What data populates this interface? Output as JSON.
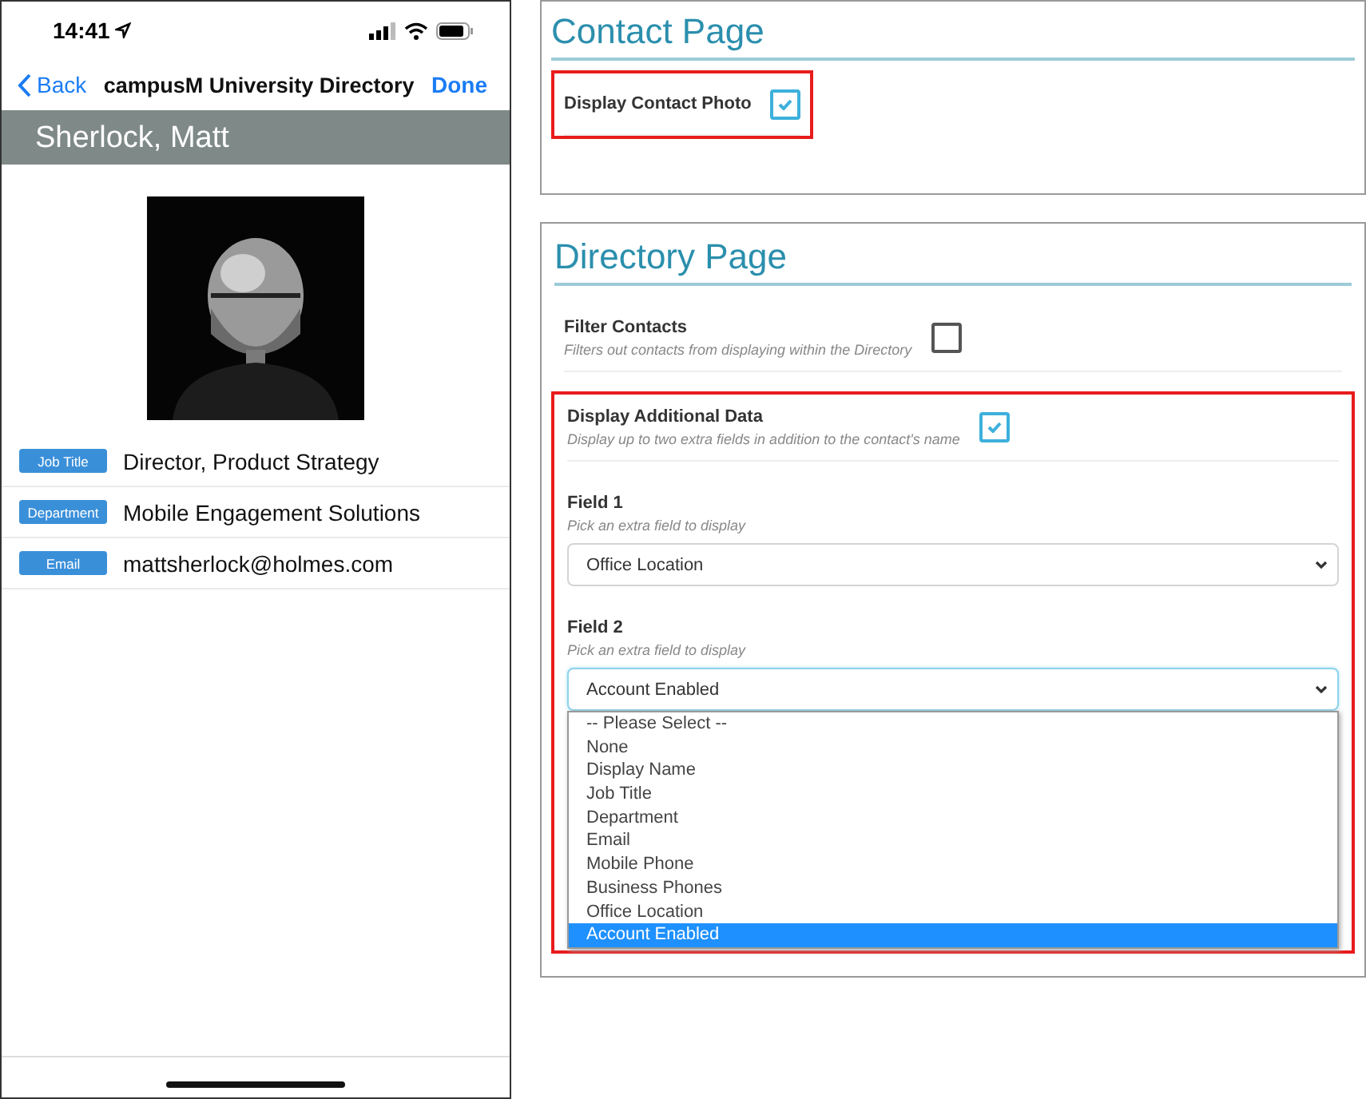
{
  "phone": {
    "status_bar": {
      "time": "14:41"
    },
    "nav": {
      "back": "Back",
      "title": "campusM University Directory",
      "done": "Done"
    },
    "contact_name": "Sherlock, Matt",
    "fields": [
      {
        "label": "Job Title",
        "value": "Director, Product Strategy"
      },
      {
        "label": "Department",
        "value": "Mobile Engagement Solutions"
      },
      {
        "label": "Email",
        "value": "mattsherlock@holmes.com"
      }
    ]
  },
  "contact_page": {
    "title": "Contact Page",
    "settings": [
      {
        "label": "Display Contact Photo",
        "checked": true,
        "highlighted": true
      }
    ]
  },
  "directory_page": {
    "title": "Directory Page",
    "settings": [
      {
        "kind": "checkbox",
        "label": "Filter Contacts",
        "description": "Filters out contacts from displaying within the Directory",
        "checked": false,
        "highlighted": false
      },
      {
        "kind": "checkbox",
        "label": "Display Additional Data",
        "description": "Display up to two extra fields in addition to the contact's name",
        "checked": true,
        "highlighted": true
      },
      {
        "kind": "select",
        "label": "Field 1",
        "description": "Pick an extra field to display",
        "value": "Office Location",
        "open": false,
        "highlighted": true
      },
      {
        "kind": "select",
        "label": "Field 2",
        "description": "Pick an extra field to display",
        "value": "Account Enabled",
        "open": true,
        "highlighted": true,
        "options": [
          {
            "label": "-- Please Select --",
            "selected": false
          },
          {
            "label": "None",
            "selected": false
          },
          {
            "label": "Display Name",
            "selected": false
          },
          {
            "label": "Job Title",
            "selected": false
          },
          {
            "label": "Department",
            "selected": false
          },
          {
            "label": "Email",
            "selected": false
          },
          {
            "label": "Mobile Phone",
            "selected": false
          },
          {
            "label": "Business Phones",
            "selected": false
          },
          {
            "label": "Office Location",
            "selected": false
          },
          {
            "label": "Account Enabled",
            "selected": true
          }
        ]
      }
    ]
  }
}
